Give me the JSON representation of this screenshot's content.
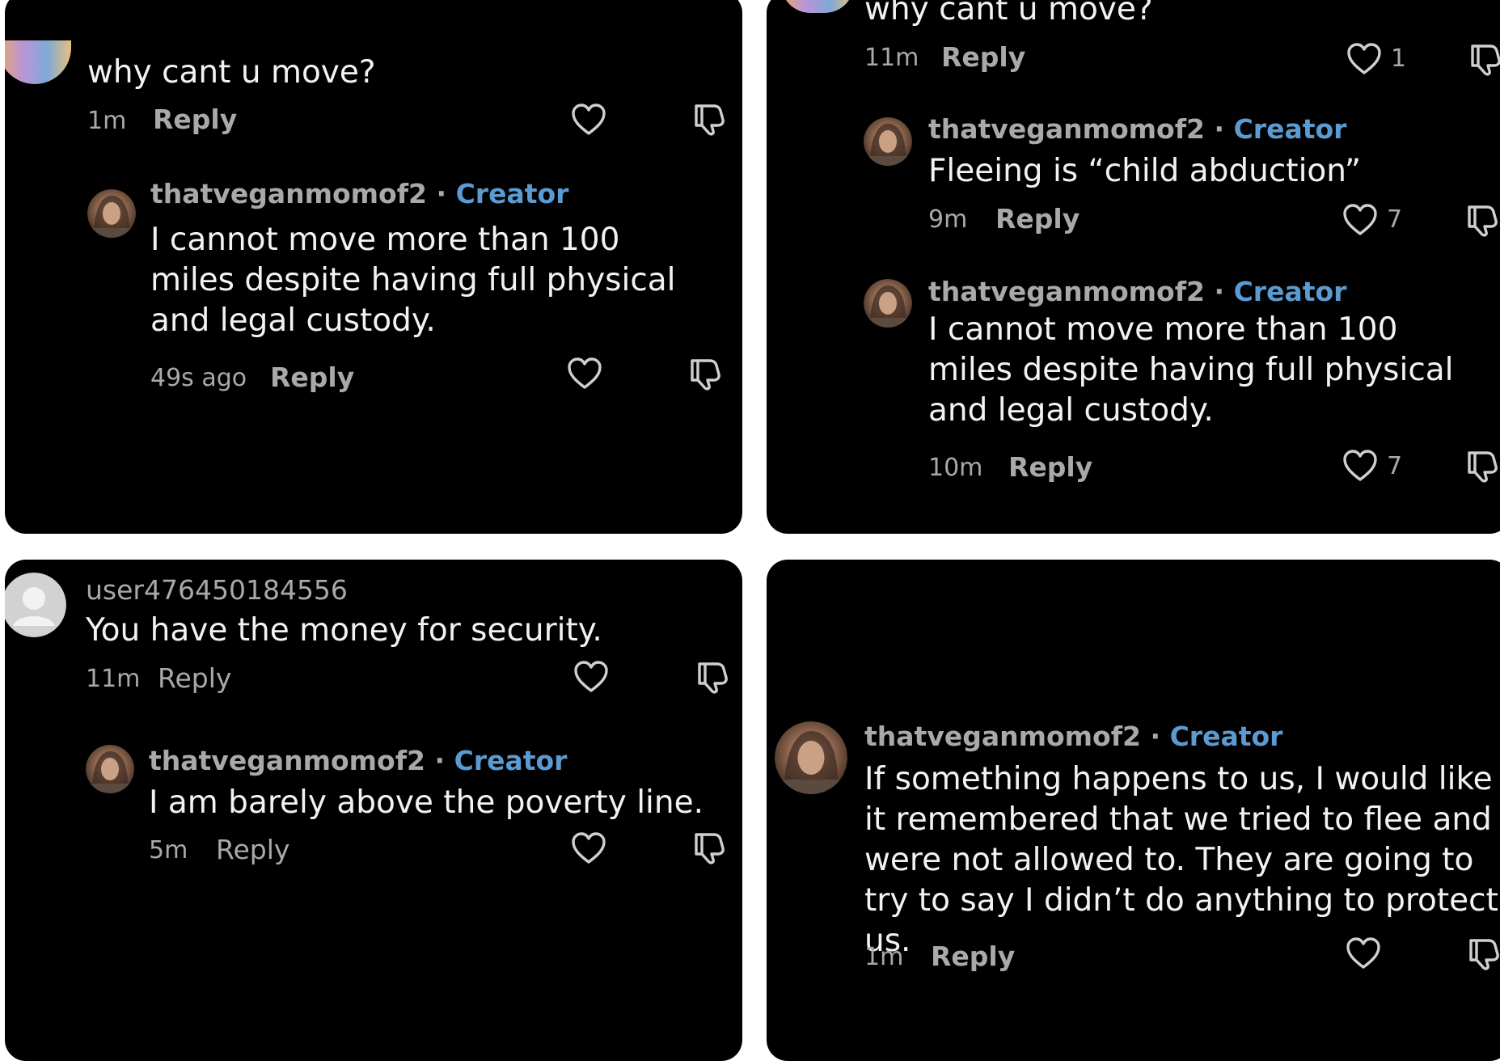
{
  "colors": {
    "panel_bg": "#000000",
    "page_bg": "#ffffff",
    "text": "#f2f2f2",
    "muted": "#a9a9a9",
    "creator_badge": "#5b9bd1"
  },
  "icons": {
    "like": "heart-outline-icon",
    "dislike": "thumbs-down-outline-icon",
    "avatar_default": "default-user-avatar-icon"
  },
  "panel1": {
    "parent": {
      "text": "why cant u move?",
      "time": "1m",
      "reply": "Reply"
    },
    "child": {
      "username": "thatveganmomof2",
      "separator": "·",
      "badge": "Creator",
      "text": "I cannot move more than 100 miles despite having full physical and legal custody.",
      "time": "49s ago",
      "reply": "Reply"
    }
  },
  "panel2": {
    "parent": {
      "text": "why cant u move?",
      "time": "11m",
      "reply": "Reply",
      "likes": "1"
    },
    "child1": {
      "username": "thatveganmomof2",
      "separator": "·",
      "badge": "Creator",
      "text": "Fleeing is “child abduction”",
      "time": "9m",
      "reply": "Reply",
      "likes": "7"
    },
    "child2": {
      "username": "thatveganmomof2",
      "separator": "·",
      "badge": "Creator",
      "text": "I cannot move more than 100 miles despite having full physical and legal custody.",
      "time": "10m",
      "reply": "Reply",
      "likes": "7"
    }
  },
  "panel3": {
    "parent": {
      "username": "user476450184556",
      "text": "You have the money for security.",
      "time": "11m",
      "reply": "Reply"
    },
    "child": {
      "username": "thatveganmomof2",
      "separator": "·",
      "badge": "Creator",
      "text": "I am barely above the poverty line.",
      "time": "5m",
      "reply": "Reply"
    }
  },
  "panel4": {
    "comment": {
      "username": "thatveganmomof2",
      "separator": "·",
      "badge": "Creator",
      "text": "If something happens to us, I would like it remembered that we tried to flee and were not allowed to. They are going to try to say I didn’t do anything to protect us.",
      "time": "1m",
      "reply": "Reply"
    }
  }
}
